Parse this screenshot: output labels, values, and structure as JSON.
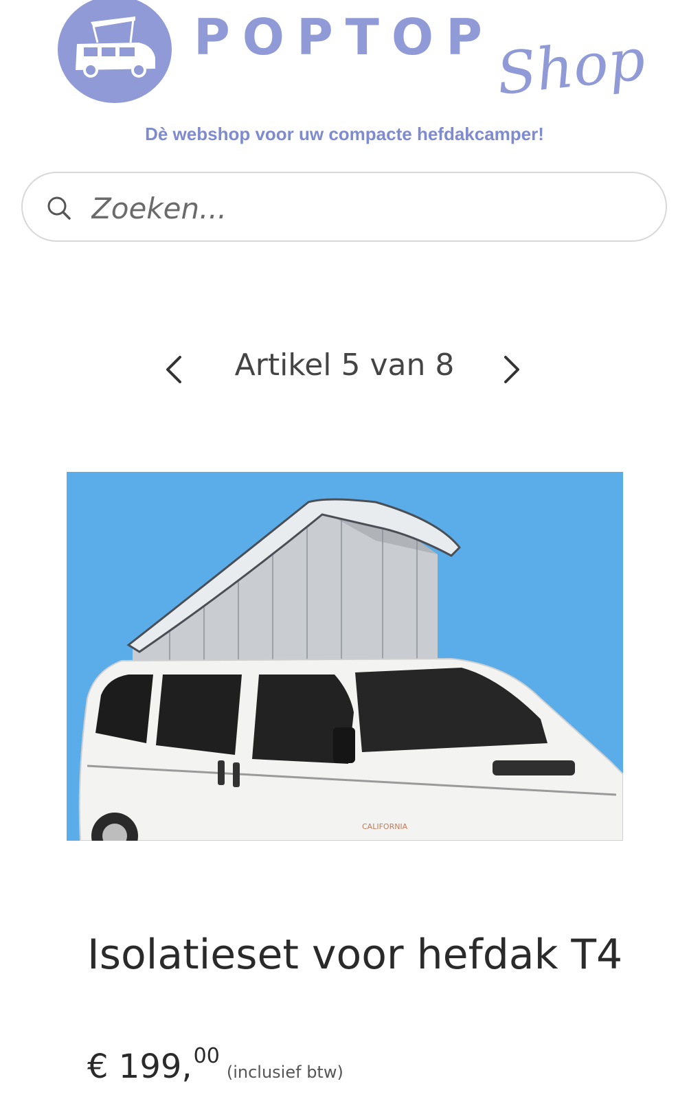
{
  "header": {
    "logo_word": "POPTOP",
    "logo_script": "Shop",
    "tagline": "Dè webshop voor uw compacte hefdakcamper!",
    "brand_color": "#8f9ad6"
  },
  "search": {
    "placeholder": "Zoeken...",
    "icon": "search-icon"
  },
  "pager": {
    "text": "Artikel 5 van 8",
    "prev_icon": "chevron-left-icon",
    "next_icon": "chevron-right-icon"
  },
  "product": {
    "image_background": "#5badea",
    "image_logo_text": "CALIFORNIA",
    "title": "Isolatieset voor hefdak T4",
    "price_main": "€ 199,",
    "price_cents": "00",
    "price_note": "(inclusief btw)"
  }
}
